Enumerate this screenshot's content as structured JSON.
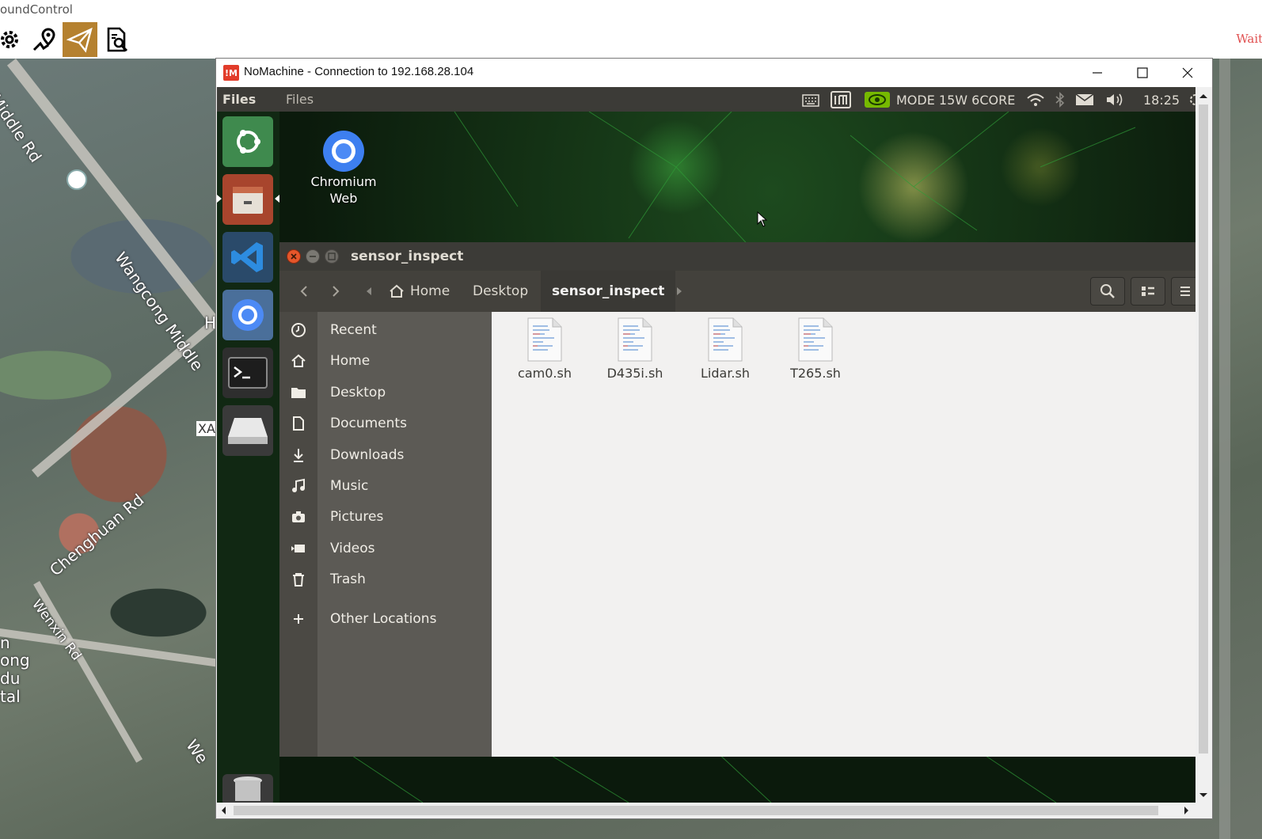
{
  "host_app": {
    "title": "oundControl",
    "status_text": "Waiti",
    "toolbar": [
      {
        "icon": "gear-icon"
      },
      {
        "icon": "plan-route-icon"
      },
      {
        "icon": "fly-paper-plane-icon",
        "active": true
      },
      {
        "icon": "analyze-report-icon"
      }
    ]
  },
  "map": {
    "labels": [
      "Middle Rd",
      "Wangcong Middle",
      "Chenghuan Rd",
      "Wenxin Rd",
      "n",
      "ong",
      "du",
      "tal",
      "We",
      "H",
      "XA"
    ]
  },
  "nomachine": {
    "title": "NoMachine - Connection to 192.168.28.104",
    "controls": {
      "minimize": "minimize-icon",
      "maximize": "maximize-icon",
      "close": "close-icon"
    }
  },
  "ubuntu": {
    "panel": {
      "app_name": "Files",
      "menu": "Files",
      "power_mode": "MODE 15W 6CORE",
      "time": "18:25",
      "tray_icons": [
        "keyboard-icon",
        "nomachine-tray-icon",
        "nvidia-icon",
        "wifi-icon",
        "bluetooth-icon",
        "mail-icon",
        "volume-icon",
        "settings-icon"
      ]
    },
    "launcher": [
      "ubuntu-dash-icon",
      "files-icon",
      "vscode-icon",
      "chromium-icon",
      "terminal-icon",
      "drive-icon",
      "trash-icon"
    ],
    "desktop": {
      "chromium_label": "Chromium Web"
    }
  },
  "files_window": {
    "title": "sensor_inspect",
    "breadcrumb": [
      "Home",
      "Desktop",
      "sensor_inspect"
    ],
    "sidebar": [
      {
        "label": "Recent",
        "icon": "clock-icon"
      },
      {
        "label": "Home",
        "icon": "home-icon"
      },
      {
        "label": "Desktop",
        "icon": "folder-icon"
      },
      {
        "label": "Documents",
        "icon": "document-icon"
      },
      {
        "label": "Downloads",
        "icon": "download-icon"
      },
      {
        "label": "Music",
        "icon": "music-icon"
      },
      {
        "label": "Pictures",
        "icon": "camera-icon"
      },
      {
        "label": "Videos",
        "icon": "video-icon"
      },
      {
        "label": "Trash",
        "icon": "trash-icon"
      },
      {
        "label": "Other Locations",
        "icon": "plus-icon"
      }
    ],
    "files": [
      "cam0.sh",
      "D435i.sh",
      "Lidar.sh",
      "T265.sh"
    ]
  }
}
